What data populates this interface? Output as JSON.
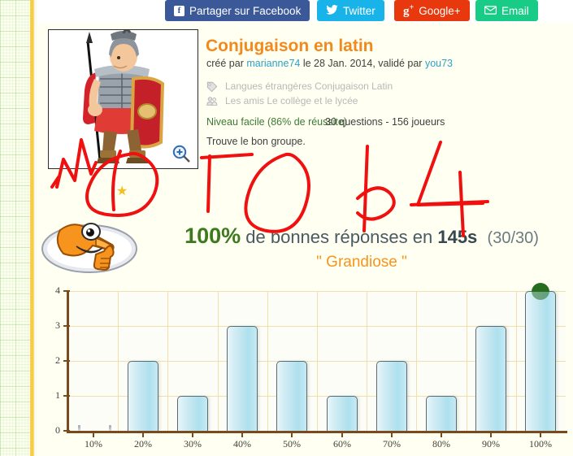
{
  "share": {
    "buttons": [
      {
        "name": "facebook",
        "label": "Partager sur Facebook",
        "glyph": "f",
        "color": "#3b5998"
      },
      {
        "name": "twitter",
        "label": "Twitter",
        "glyph": "🐦",
        "color": "#18b3e8"
      },
      {
        "name": "google",
        "label": "Google+",
        "glyph": "g+",
        "color": "#e8380d"
      },
      {
        "name": "email",
        "label": "Email",
        "glyph": "✉",
        "color": "#18cc87"
      }
    ]
  },
  "quiz": {
    "title": "Conjugaison en latin",
    "byline_prefix": "créé par ",
    "author": "marianne74",
    "byline_mid": " le 28 Jan. 2014, validé par ",
    "validator": "you73",
    "tags_icon": "tag-icon",
    "tags": "Langues étrangères   Conjugaison   Latin",
    "groups_icon": "group-icon",
    "groups": "Les amis   Le collège et le lycée",
    "level": "Niveau facile (86% de réussite)",
    "counts": "30 questions - 156 joueurs",
    "description": "Trouve le bon groupe.",
    "thumbnail_alt": "roman-legionary-illustration",
    "zoom_icon": "magnifier-plus-icon",
    "star_icon": "star-icon"
  },
  "result": {
    "mascot": "fox-thumbs-up-mascot",
    "percent": "100%",
    "text_mid": " de bonnes réponses en ",
    "time": "145s",
    "score": "(30/30)",
    "comment": "\" Grandiose \""
  },
  "chart_data": {
    "type": "bar",
    "title": "",
    "xlabel": "",
    "ylabel": "",
    "categories": [
      "10%",
      "20%",
      "30%",
      "40%",
      "50%",
      "60%",
      "70%",
      "80%",
      "90%",
      "100%"
    ],
    "values": [
      0,
      2,
      1,
      3,
      2,
      1,
      2,
      1,
      3,
      4
    ],
    "ylim": [
      0,
      4
    ],
    "yticks": [
      0,
      1,
      2,
      3,
      4
    ],
    "grid": true,
    "legend": false,
    "bar_color": "#bfe5f0",
    "bar_border": "#5a6b70",
    "grid_color": "#f2dfae",
    "axis_color": "#7a4a1c",
    "marker": {
      "category": "100%",
      "value": 4,
      "color": "#276d20",
      "name": "player-result-marker"
    }
  },
  "annotations": {
    "color": "#f01010",
    "note": "handwritten red marker scribbles over the page"
  },
  "colors": {
    "title": "#f18a1e",
    "link": "#2fa0c8",
    "level": "#3d7a34",
    "comment": "#f7941e",
    "percent": "#3d7a1e",
    "page_bg": "#fffff2",
    "paper_rule": "#f7c53b"
  }
}
